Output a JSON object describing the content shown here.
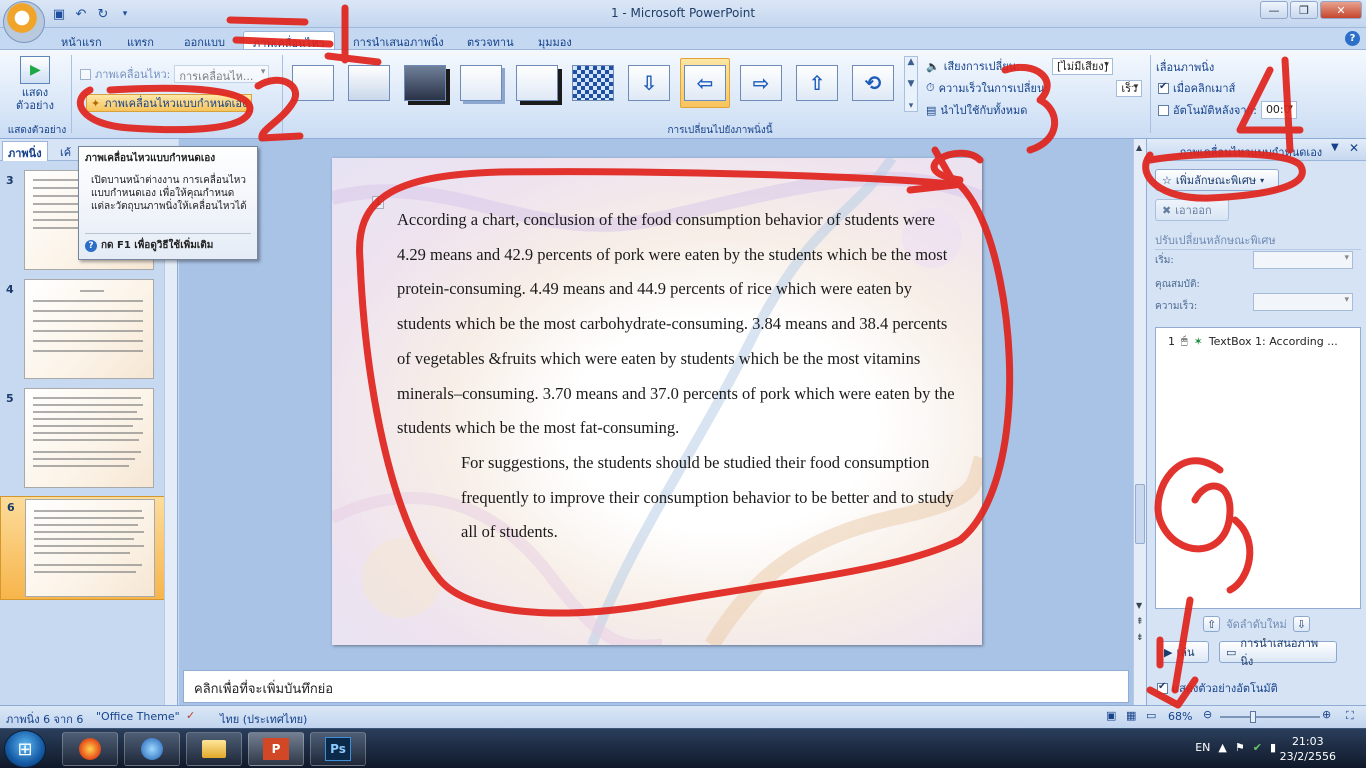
{
  "window": {
    "title": "1 - Microsoft PowerPoint"
  },
  "ribbon_tabs": [
    {
      "label": "หน้าแรก"
    },
    {
      "label": "แทรก"
    },
    {
      "label": "ออกแบบ"
    },
    {
      "label": "ภาพเคลื่อนไหว"
    },
    {
      "label": "การนำเสนอภาพนิ่ง"
    },
    {
      "label": "ตรวจทาน"
    },
    {
      "label": "มุมมอง"
    }
  ],
  "ribbon": {
    "preview_label": "แสดงตัวอย่าง",
    "preview_group": "แสดงตัวอย่าง",
    "anim_label": "ภาพเคลื่อนไหว:",
    "anim_combo": "การเคลื่อนไห...",
    "custom_anim_button": "ภาพเคลื่อนไหวแบบกำหนดเอง",
    "transition_group": "การเปลี่ยนไปยังภาพนิ่งนี้",
    "sound_label": "เสียงการเปลี่ยน:",
    "sound_value": "[ไม่มีเสียง]",
    "speed_label": "ความเร็วในการเปลี่ยน:",
    "speed_value": "เร็ว",
    "apply_all_label": "นำไปใช้กับทั้งหมด",
    "advance_group": "เลื่อนภาพนิ่ง",
    "on_click_label": "เมื่อคลิกเมาส์",
    "auto_after_label": "อัตโนมัติหลังจาก:",
    "auto_after_value": "00:0"
  },
  "tooltip": {
    "title": "ภาพเคลื่อนไหวแบบกำหนดเอง",
    "body": "เปิดบานหน้าต่างงาน การเคลื่อนไหวแบบกำหนดเอง เพื่อให้คุณกำหนดแต่ละวัตถุบนภาพนิ่งให้เคลื่อนไหวได้",
    "help": "กด F1 เพื่อดูวิธีใช้เพิ่มเติม"
  },
  "left_pane": {
    "tab_slides": "ภาพนิ่ง",
    "tab_outline": "เค้",
    "slides": [
      {
        "num": "3"
      },
      {
        "num": "4"
      },
      {
        "num": "5"
      },
      {
        "num": "6"
      }
    ]
  },
  "slide": {
    "anim_tag": "1",
    "paragraphs": [
      "According a chart, conclusion of the food consumption behavior of students were 4.29 means and 42.9 percents of pork were eaten  by the students which be the most protein-consuming.  4.49 means and 44.9 percents of rice which were eaten by students which be the most carbohydrate-consuming. 3.84 means and 38.4 percents of vegetables &fruits which were eaten by students which be the most vitamins minerals–consuming. 3.70 means and 37.0 percents of pork  which were eaten by the students which be the most fat-consuming.",
      "For  suggestions, the students should be studied their food consumption frequently to improve their consumption behavior to be better and to study all of students."
    ]
  },
  "notes": {
    "placeholder": "คลิกเพื่อที่จะเพิ่มบันทึกย่อ"
  },
  "right_pane": {
    "title": "ภาพเคลื่อนไหวแบบกำหนดเอง",
    "add_effect": "เพิ่มลักษณะพิเศษ",
    "remove": "เอาออก",
    "modify_header": "ปรับเปลี่ยนหลักษณะพิเศษ",
    "start_label": "เริ่ม:",
    "property_label": "คุณสมบัติ:",
    "speed_label": "ความเร็ว:",
    "anim_item_num": "1",
    "anim_item_text": "TextBox 1: According ...",
    "reorder_label": "จัดลำดับใหม่",
    "play_button": "เล่น",
    "slideshow_button": "การนำเสนอภาพนิ่ง",
    "autopreview_label": "แสดงตัวอย่างอัตโนมัติ"
  },
  "status": {
    "slide_info": "ภาพนิ่ง 6 จาก 6",
    "theme": "\"Office Theme\"",
    "language": "ไทย (ประเทศไทย)",
    "zoom": "68%"
  },
  "taskbar": {
    "lang": "EN",
    "time": "21:03",
    "date": "23/2/2556",
    "ps_label": "Ps"
  }
}
